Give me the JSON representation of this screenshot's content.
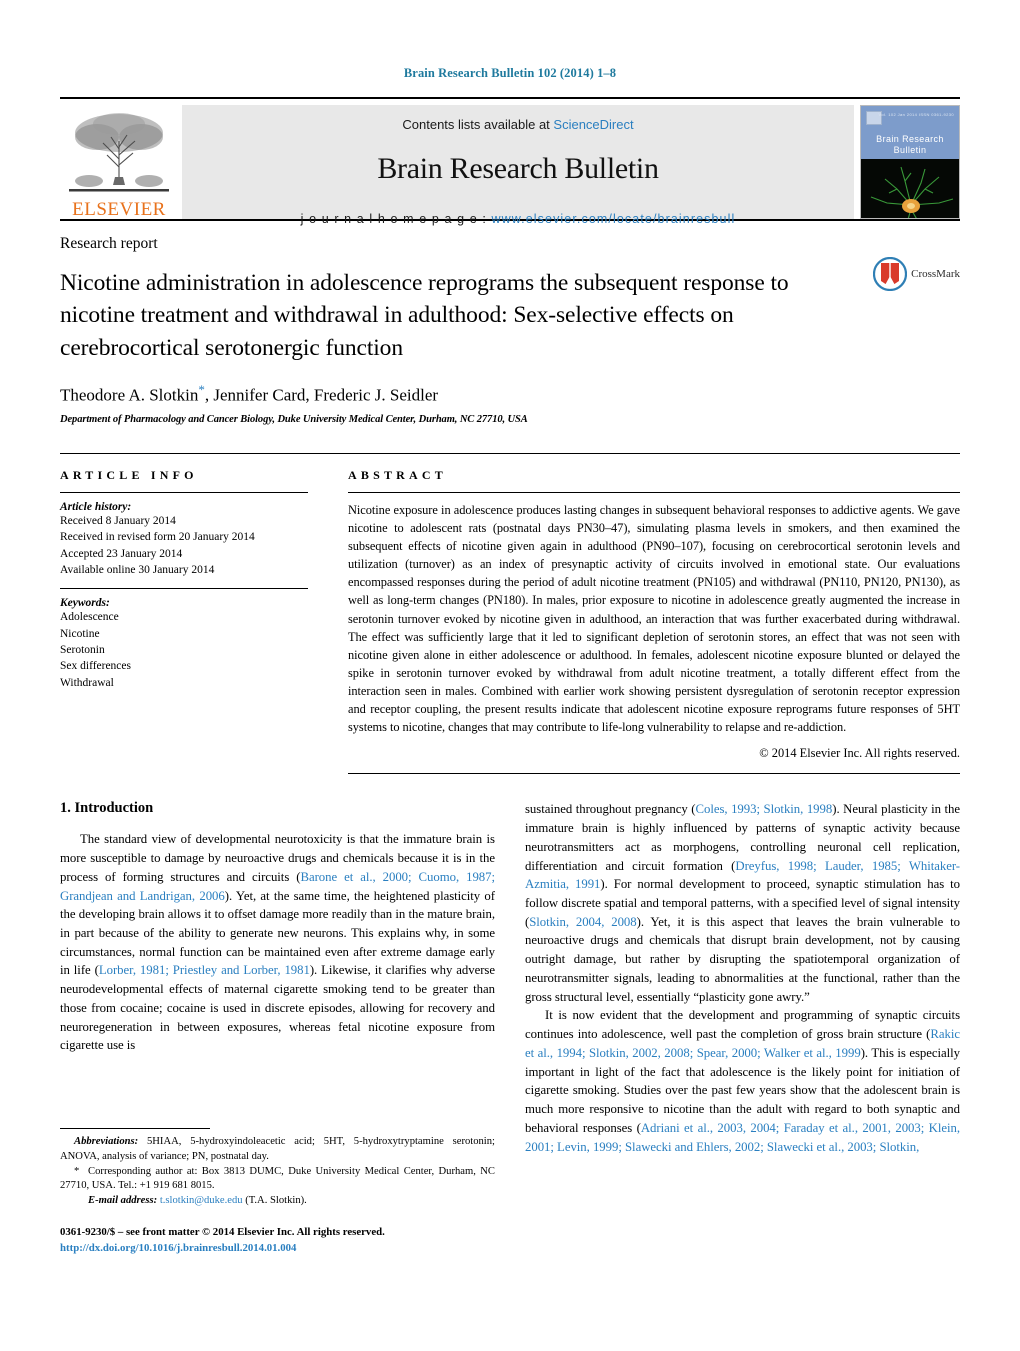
{
  "running_head": "Brain Research Bulletin 102 (2014) 1–8",
  "banner": {
    "publisher_name": "ELSEVIER",
    "contents_prefix": "Contents lists available at ",
    "contents_link": "ScienceDirect",
    "journal_name": "Brain Research Bulletin",
    "homepage_prefix": "j o u r n a l   h o m e p a g e :   ",
    "homepage_url": "www.elsevier.com/locate/brainresbull",
    "cover_title": "Brain Research\nBulletin",
    "cover_issue": "Vol. 102  Jan 2014   ISSN 0361-9230"
  },
  "article": {
    "type": "Research report",
    "title": "Nicotine administration in adolescence reprograms the subsequent response to nicotine treatment and withdrawal in adulthood: Sex-selective effects on cerebrocortical serotonergic function",
    "authors": "Theodore A. Slotkin",
    "authors_rest": ", Jennifer Card, Frederic J. Seidler",
    "corresponding_marker": "*",
    "affiliation": "Department of Pharmacology and Cancer Biology, Duke University Medical Center, Durham, NC 27710, USA",
    "crossmark_label": "CrossMark"
  },
  "article_info": {
    "heading": "ARTICLE INFO",
    "history_label": "Article history:",
    "history": [
      "Received 8 January 2014",
      "Received in revised form 20 January 2014",
      "Accepted 23 January 2014",
      "Available online 30 January 2014"
    ],
    "keywords_label": "Keywords:",
    "keywords": [
      "Adolescence",
      "Nicotine",
      "Serotonin",
      "Sex differences",
      "Withdrawal"
    ]
  },
  "abstract": {
    "heading": "ABSTRACT",
    "text": "Nicotine exposure in adolescence produces lasting changes in subsequent behavioral responses to addictive agents. We gave nicotine to adolescent rats (postnatal days PN30–47), simulating plasma levels in smokers, and then examined the subsequent effects of nicotine given again in adulthood (PN90–107), focusing on cerebrocortical serotonin levels and utilization (turnover) as an index of presynaptic activity of circuits involved in emotional state. Our evaluations encompassed responses during the period of adult nicotine treatment (PN105) and withdrawal (PN110, PN120, PN130), as well as long-term changes (PN180). In males, prior exposure to nicotine in adolescence greatly augmented the increase in serotonin turnover evoked by nicotine given in adulthood, an interaction that was further exacerbated during withdrawal. The effect was sufficiently large that it led to significant depletion of serotonin stores, an effect that was not seen with nicotine given alone in either adolescence or adulthood. In females, adolescent nicotine exposure blunted or delayed the spike in serotonin turnover evoked by withdrawal from adult nicotine treatment, a totally different effect from the interaction seen in males. Combined with earlier work showing persistent dysregulation of serotonin receptor expression and receptor coupling, the present results indicate that adolescent nicotine exposure reprograms future responses of 5HT systems to nicotine, changes that may contribute to life-long vulnerability to relapse and re-addiction.",
    "copyright": "© 2014 Elsevier Inc. All rights reserved."
  },
  "introduction": {
    "heading": "1. Introduction",
    "left_para_1_a": "The standard view of developmental neurotoxicity is that the immature brain is more susceptible to damage by neuroactive drugs and chemicals because it is in the process of forming structures and circuits (",
    "left_ref_1": "Barone et al., 2000; Cuomo, 1987; Grandjean and Landrigan, 2006",
    "left_para_1_b": "). Yet, at the same time, the heightened plasticity of the developing brain allows it to offset damage more readily than in the mature brain, in part because of the ability to generate new neurons. This explains why, in some circumstances, normal function can be maintained even after extreme damage early in life (",
    "left_ref_2": "Lorber, 1981; Priestley and Lorber, 1981",
    "left_para_1_c": "). Likewise, it clarifies why adverse neurodevelopmental effects of maternal cigarette smoking tend to be greater than those from cocaine; cocaine is used in discrete episodes, allowing for recovery and neuroregeneration in between exposures, whereas fetal nicotine exposure from cigarette use is",
    "right_para_1_a": "sustained throughout pregnancy (",
    "right_ref_1": "Coles, 1993; Slotkin, 1998",
    "right_para_1_b": "). Neural plasticity in the immature brain is highly influenced by patterns of synaptic activity because neurotransmitters act as morphogens, controlling neuronal cell replication, differentiation and circuit formation (",
    "right_ref_2": "Dreyfus, 1998; Lauder, 1985; Whitaker-Azmitia, 1991",
    "right_para_1_c": "). For normal development to proceed, synaptic stimulation has to follow discrete spatial and temporal patterns, with a specified level of signal intensity (",
    "right_ref_3": "Slotkin, 2004, 2008",
    "right_para_1_d": "). Yet, it is this aspect that leaves the brain vulnerable to neuroactive drugs and chemicals that disrupt brain development, not by causing outright damage, but rather by disrupting the spatiotemporal organization of neurotransmitter signals, leading to abnormalities at the functional, rather than the gross structural level, essentially “plasticity gone awry.”",
    "right_para_2_a": "It is now evident that the development and programming of synaptic circuits continues into adolescence, well past the completion of gross brain structure (",
    "right_ref_4": "Rakic et al., 1994; Slotkin, 2002, 2008; Spear, 2000; Walker et al., 1999",
    "right_para_2_b": "). This is especially important in light of the fact that adolescence is the likely point for initiation of cigarette smoking. Studies over the past few years show that the adolescent brain is much more responsive to nicotine than the adult with regard to both synaptic and behavioral responses (",
    "right_ref_5": "Adriani et al., 2003, 2004; Faraday et al., 2001, 2003; Klein, 2001; Levin, 1999; Slawecki and Ehlers, 2002; Slawecki et al., 2003; Slotkin,"
  },
  "footnotes": {
    "abbrev_label": "Abbreviations:",
    "abbrev_text": "  5HIAA, 5-hydroxyindoleacetic acid; 5HT, 5-hydroxytryptamine serotonin; ANOVA, analysis of variance; PN, postnatal day.",
    "corresponding_marker": "*",
    "corresponding_text": "Corresponding author at: Box 3813 DUMC, Duke University Medical Center, Durham, NC 27710, USA. Tel.: +1 919 681 8015.",
    "email_label": "E-mail address:",
    "email": "t.slotkin@duke.edu",
    "email_suffix": " (T.A. Slotkin).",
    "issn_line": "0361-9230/$ – see front matter © 2014 Elsevier Inc. All rights reserved.",
    "doi": "http://dx.doi.org/10.1016/j.brainresbull.2014.01.004"
  },
  "colors": {
    "link_blue": "#2a7fc0",
    "running_head_blue": "#1f7a9e",
    "elsevier_orange": "#E8721C",
    "banner_gray": "#e8e8e8"
  }
}
